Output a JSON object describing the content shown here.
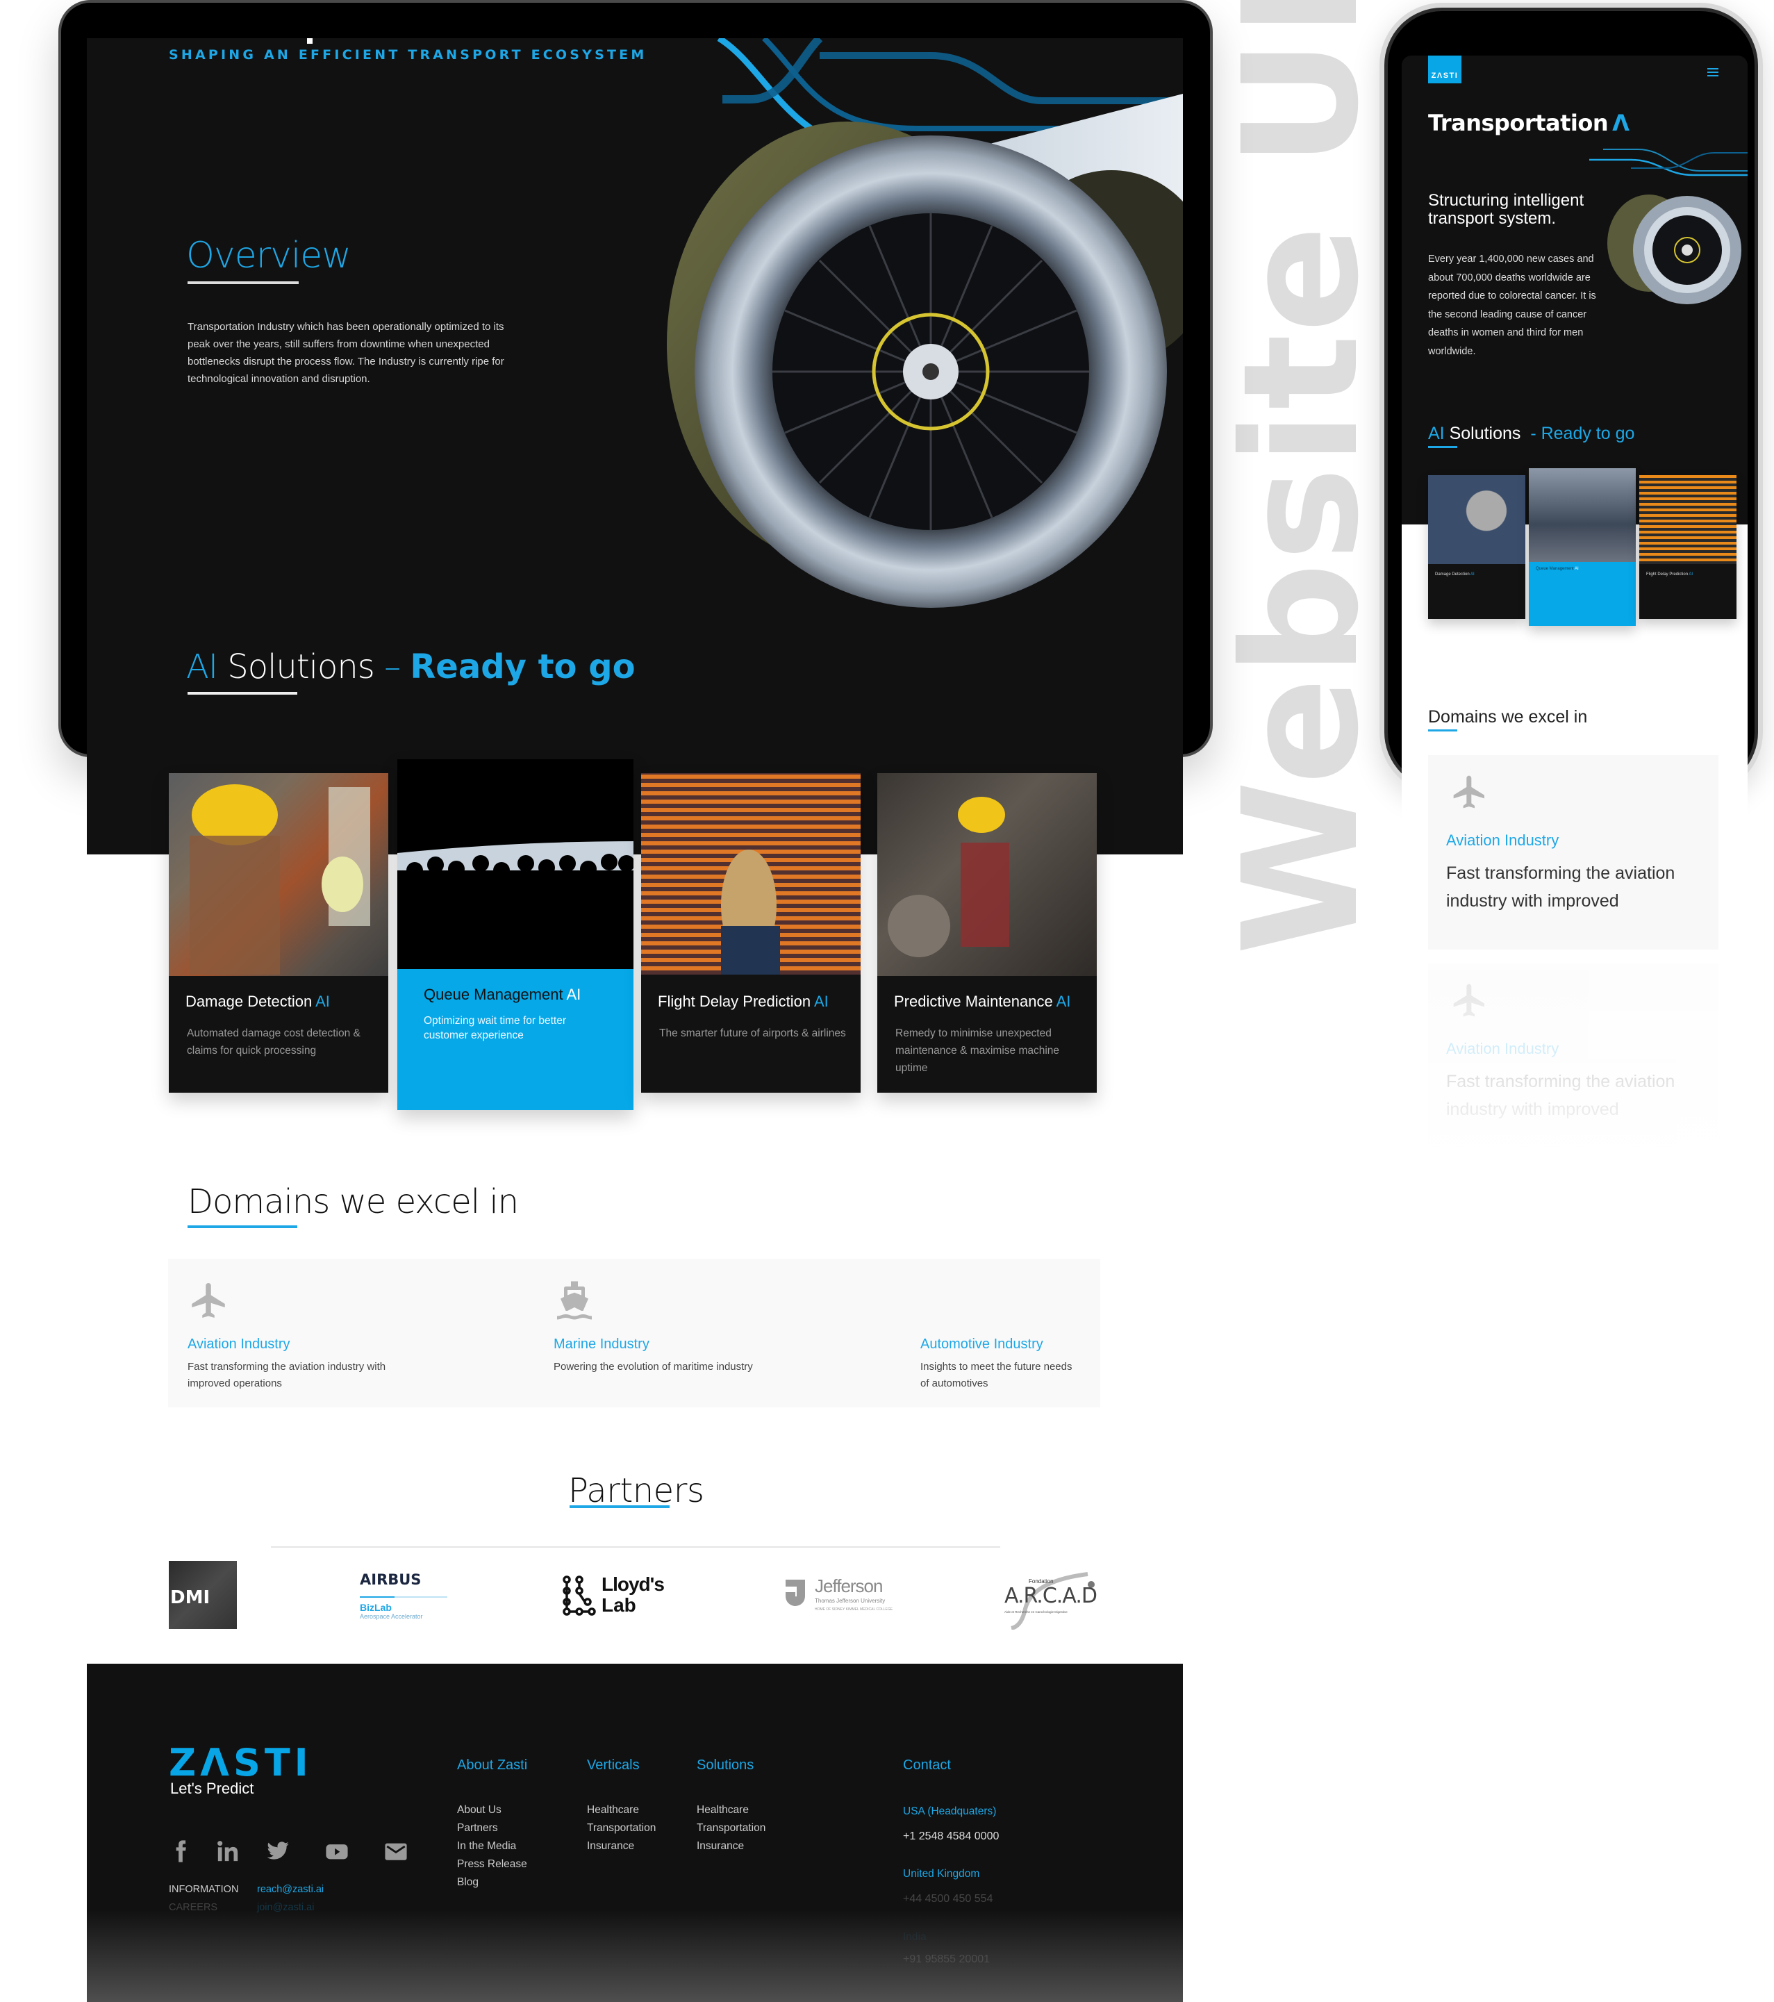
{
  "watermark": "Website UI",
  "desktop": {
    "tagline": "SHAPING AN EFFICIENT TRANSPORT ECOSYSTEM",
    "overview": {
      "title": "Overview",
      "text": "Transportation Industry which has been operationally optimized to its peak over the years, still suffers from downtime when unexpected bottlenecks disrupt the process flow. The Industry is currently ripe for technological innovation and disruption."
    },
    "ai_solutions": {
      "title_ai": "AI",
      "title_rest": " Solutions",
      "dash": " – ",
      "title_bold": "Ready to go",
      "cards": [
        {
          "title": "Damage Detection ",
          "ai": "AI",
          "desc": "Automated damage cost detection & claims for quick processing",
          "image": "worker-in-hard-hat-photo",
          "active": false
        },
        {
          "title": "Queue Management ",
          "ai": "AI",
          "desc": "Optimizing wait time for better customer experience",
          "image": "crowd-silhouette-photo",
          "active": true
        },
        {
          "title": "Flight Delay Prediction ",
          "ai": "AI",
          "desc": "The smarter future of airports & airlines",
          "image": "departures-board-photo",
          "active": false
        },
        {
          "title": "Predictive Maintenance ",
          "ai": "AI",
          "desc": "Remedy to minimise unexpected maintenance & maximise machine uptime",
          "image": "engine-mechanic-photo",
          "active": false
        }
      ]
    },
    "domains": {
      "title": "Domains we excel in",
      "items": [
        {
          "icon": "airplane-icon",
          "name": "Aviation Industry",
          "desc": "Fast transforming the aviation industry with improved operations"
        },
        {
          "icon": "ship-icon",
          "name": "Marine Industry",
          "desc": "Powering the evolution of maritime industry"
        },
        {
          "icon": "",
          "name": "Automotive Industry",
          "desc": "Insights to meet the future needs of automotives"
        }
      ]
    },
    "partners": {
      "title": "Partners",
      "logos": [
        {
          "name": "DMI",
          "text": "DMI"
        },
        {
          "name": "Airbus BizLab",
          "text": "AIRBUS",
          "sub": "BizLab",
          "sub2": "Aerospace Accelerator"
        },
        {
          "name": "Lloyd's Lab",
          "text": "Lloyd's",
          "sub": "Lab"
        },
        {
          "name": "Jefferson",
          "text": "Jefferson",
          "sub": "Thomas Jefferson University",
          "sub2": "HOME OF SIDNEY KIMMEL MEDICAL COLLEGE"
        },
        {
          "name": "A.R.C.A.D",
          "text": "A.R.C.A.D",
          "sub": "Fondation",
          "sub2": "Aide et Recherche en Cancérologie Digestive"
        }
      ]
    },
    "footer": {
      "logo": "ZΛSTI",
      "tagline": "Let's Predict",
      "social": [
        "facebook-icon",
        "linkedin-icon",
        "twitter-icon",
        "youtube-icon",
        "mail-icon"
      ],
      "info": [
        {
          "label": "INFORMATION",
          "email": "reach@zasti.ai"
        },
        {
          "label": "CAREERS",
          "email": "join@zasti.ai"
        }
      ],
      "columns": [
        {
          "heading": "About Zasti",
          "links": [
            "About Us",
            "Partners",
            "In the Media",
            "Press Release",
            "Blog"
          ]
        },
        {
          "heading": "Verticals",
          "links": [
            "Healthcare",
            "Transportation",
            "Insurance"
          ]
        },
        {
          "heading": "Solutions",
          "links": [
            "Healthcare",
            "Transportation",
            "Insurance"
          ]
        }
      ],
      "contact": {
        "heading": "Contact",
        "offices": [
          {
            "region": "USA (Headquaters)",
            "phone": "+1 2548 4584 0000"
          },
          {
            "region": "United Kingdom",
            "phone": "+44 4500 450 554"
          },
          {
            "region": "India",
            "phone": "+91 95855 20001"
          }
        ]
      }
    }
  },
  "mobile": {
    "logo": "ZΛSTI",
    "title": "Transportation",
    "subtitle": "Structuring intelligent transport system.",
    "body": "Every year 1,400,000 new cases and about 700,000 deaths worldwide are reported due to colorectal cancer. It is the second leading cause of cancer deaths in women and third for men worldwide.",
    "ai_title_ai": "AI",
    "ai_title_rest": " Solutions",
    "ai_title_ready": "  - Ready to go",
    "cards": [
      {
        "title": "Damage Detection ",
        "ai": "AI",
        "active": false
      },
      {
        "title": "Queue Management ",
        "ai": "AI",
        "active": true
      },
      {
        "title": "Flight Delay Prediction ",
        "ai": "AI",
        "active": false
      }
    ],
    "domains_title": "Domains we excel in",
    "domains": [
      {
        "name": "Aviation Industry",
        "desc": "Fast transforming the aviation industry with improved"
      },
      {
        "name": "Aviation Industry",
        "desc": "Fast transforming the aviation industry with improved"
      }
    ]
  },
  "colors": {
    "accent": "#1ea7e6",
    "active_card": "#06a8e8",
    "dark_bg": "#111111",
    "watermark": "#dddddd"
  }
}
